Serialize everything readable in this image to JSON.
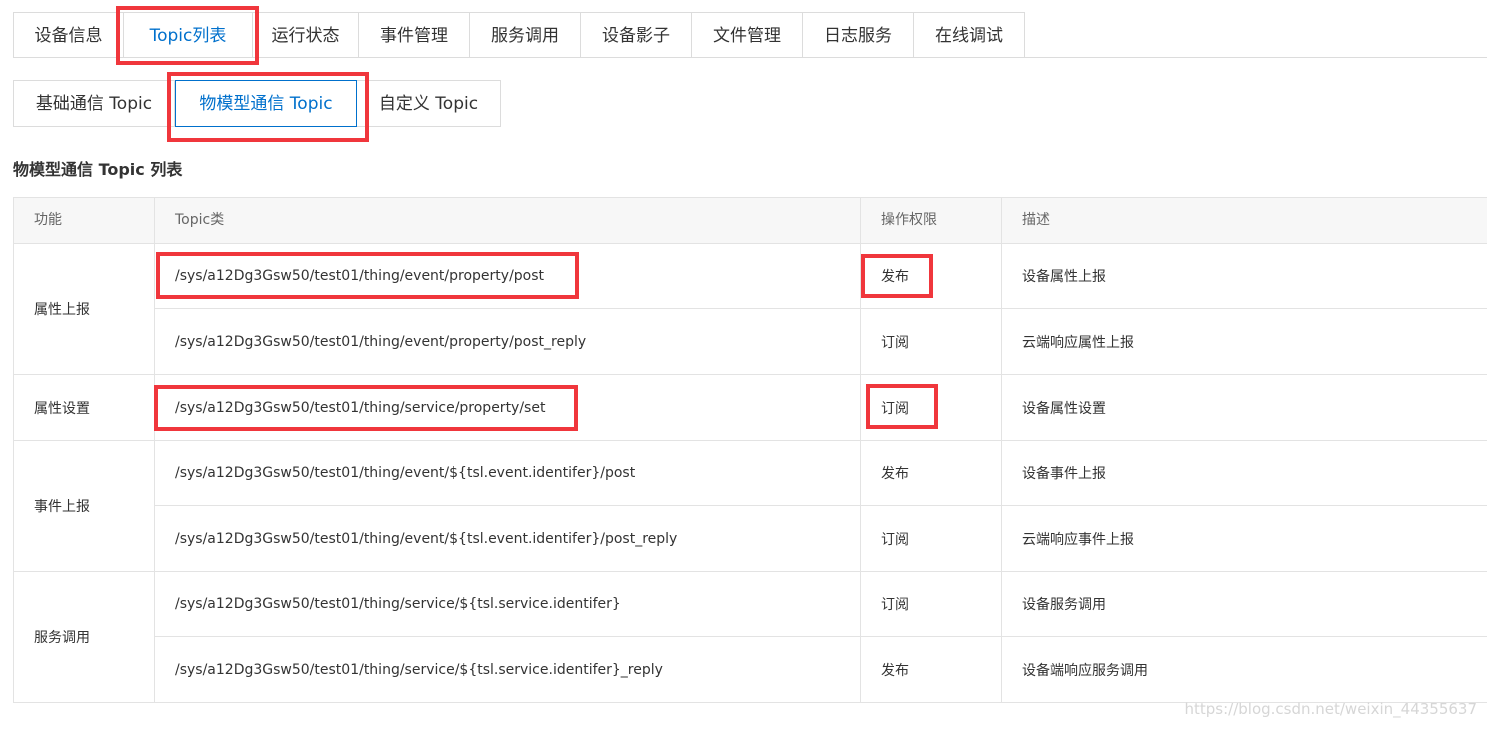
{
  "primary_tabs": [
    {
      "label": "设备信息"
    },
    {
      "label": "Topic列表"
    },
    {
      "label": "运行状态"
    },
    {
      "label": "事件管理"
    },
    {
      "label": "服务调用"
    },
    {
      "label": "设备影子"
    },
    {
      "label": "文件管理"
    },
    {
      "label": "日志服务"
    },
    {
      "label": "在线调试"
    }
  ],
  "secondary_tabs": [
    {
      "label": "基础通信 Topic"
    },
    {
      "label": "物模型通信 Topic"
    },
    {
      "label": "自定义 Topic"
    }
  ],
  "section_title": "物模型通信 Topic 列表",
  "table": {
    "headers": [
      "功能",
      "Topic类",
      "操作权限",
      "描述"
    ],
    "groups": [
      {
        "name": "属性上报",
        "rows": [
          {
            "topic": "/sys/a12Dg3Gsw50/test01/thing/event/property/post",
            "perm": "发布",
            "desc": "设备属性上报"
          },
          {
            "topic": "/sys/a12Dg3Gsw50/test01/thing/event/property/post_reply",
            "perm": "订阅",
            "desc": "云端响应属性上报"
          }
        ]
      },
      {
        "name": "属性设置",
        "rows": [
          {
            "topic": "/sys/a12Dg3Gsw50/test01/thing/service/property/set",
            "perm": "订阅",
            "desc": "设备属性设置"
          }
        ]
      },
      {
        "name": "事件上报",
        "rows": [
          {
            "topic": "/sys/a12Dg3Gsw50/test01/thing/event/${tsl.event.identifer}/post",
            "perm": "发布",
            "desc": "设备事件上报"
          },
          {
            "topic": "/sys/a12Dg3Gsw50/test01/thing/event/${tsl.event.identifer}/post_reply",
            "perm": "订阅",
            "desc": "云端响应事件上报"
          }
        ]
      },
      {
        "name": "服务调用",
        "rows": [
          {
            "topic": "/sys/a12Dg3Gsw50/test01/thing/service/${tsl.service.identifer}",
            "perm": "订阅",
            "desc": "设备服务调用"
          },
          {
            "topic": "/sys/a12Dg3Gsw50/test01/thing/service/${tsl.service.identifer}_reply",
            "perm": "发布",
            "desc": "设备端响应服务调用"
          }
        ]
      }
    ]
  },
  "watermark": "https://blog.csdn.net/weixin_44355637",
  "colors": {
    "accent": "#0070cc",
    "highlight": "#f0363c"
  }
}
